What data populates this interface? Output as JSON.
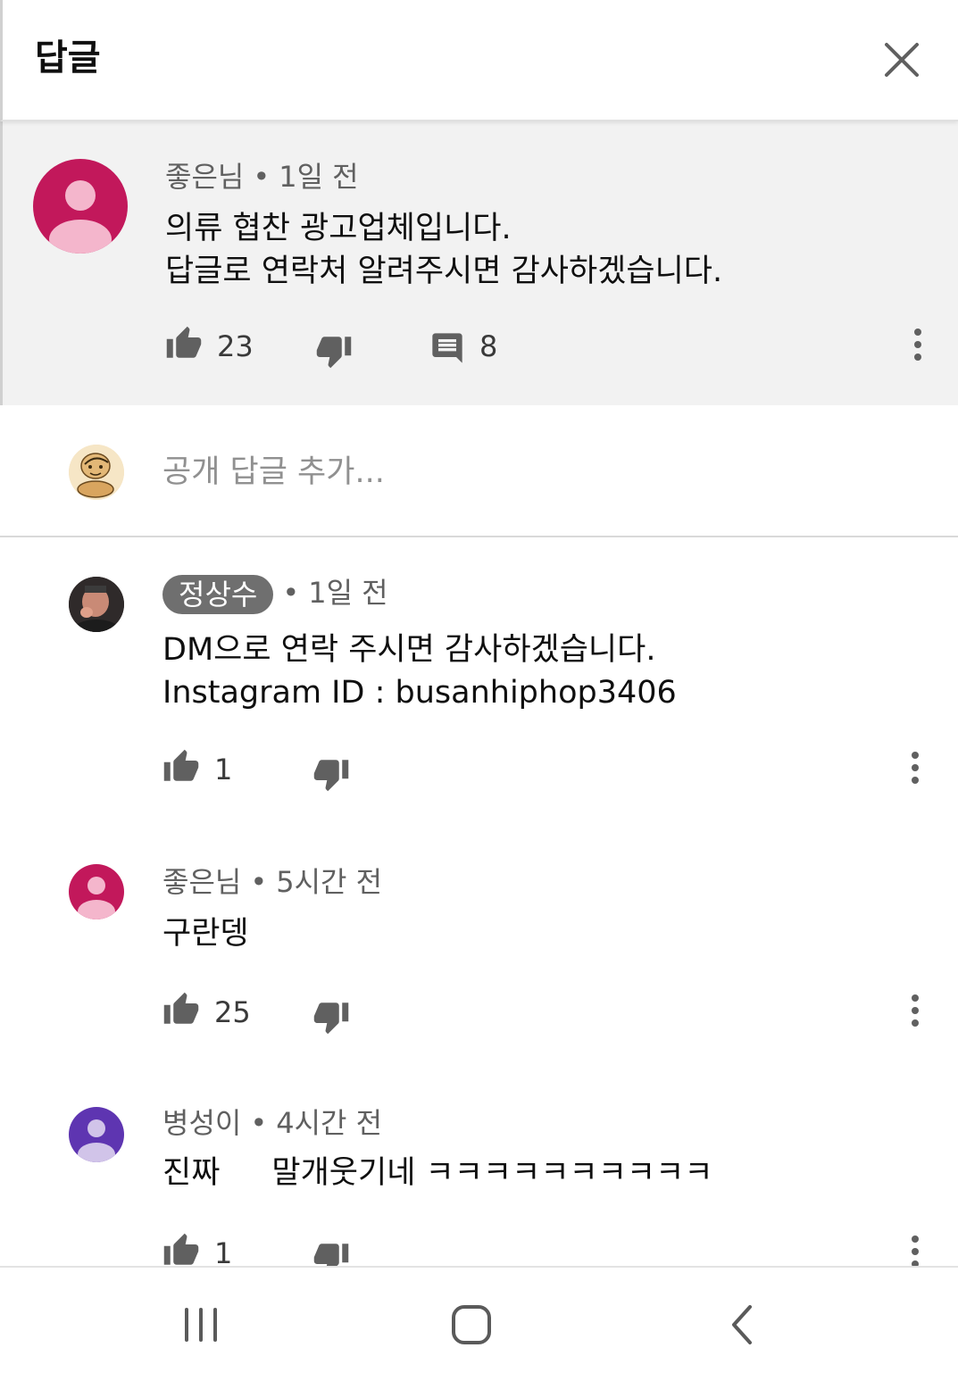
{
  "header": {
    "title": "답글",
    "close_icon": "close-icon"
  },
  "main_comment": {
    "author": "좋은님",
    "separator": "•",
    "time": "1일 전",
    "text_line1": "의류 협찬 광고업체입니다.",
    "text_line2": "답글로 연락처 알려주시면 감사하겠습니다.",
    "likes": "23",
    "replies": "8",
    "avatar_color": "#c2185b",
    "avatar_icon": "person-icon"
  },
  "reply_box": {
    "placeholder": "공개 답글 추가..."
  },
  "replies": [
    {
      "author": "정상수",
      "separator": "•",
      "time": "1일 전",
      "text_line1": "DM으로 연락 주시면 감사하겠습니다.",
      "text_line2": "Instagram ID : busanhiphop3406",
      "likes": "1",
      "avatar_icon": "person-photo-icon"
    },
    {
      "author": "좋은님",
      "separator": "•",
      "time": "5시간 전",
      "text_line1": "구란뎅",
      "likes": "25",
      "avatar_color": "#c2185b",
      "avatar_icon": "person-icon"
    },
    {
      "author": "병성이",
      "separator": "•",
      "time": "4시간 전",
      "text_prefix": "진짜",
      "text_suffix": "말개웃기네 ㅋㅋㅋㅋㅋㅋㅋㅋㅋㅋ",
      "likes": "1",
      "avatar_color": "#5e35b1",
      "avatar_icon": "person-icon"
    }
  ],
  "colors": {
    "highlight_bg": "#f2f2f2",
    "meta_text": "#606060",
    "author_chip": "#6f6f6f",
    "icon": "#606060"
  },
  "navbar": {
    "recents_icon": "recents-icon",
    "home_icon": "home-icon",
    "back_icon": "back-icon"
  }
}
